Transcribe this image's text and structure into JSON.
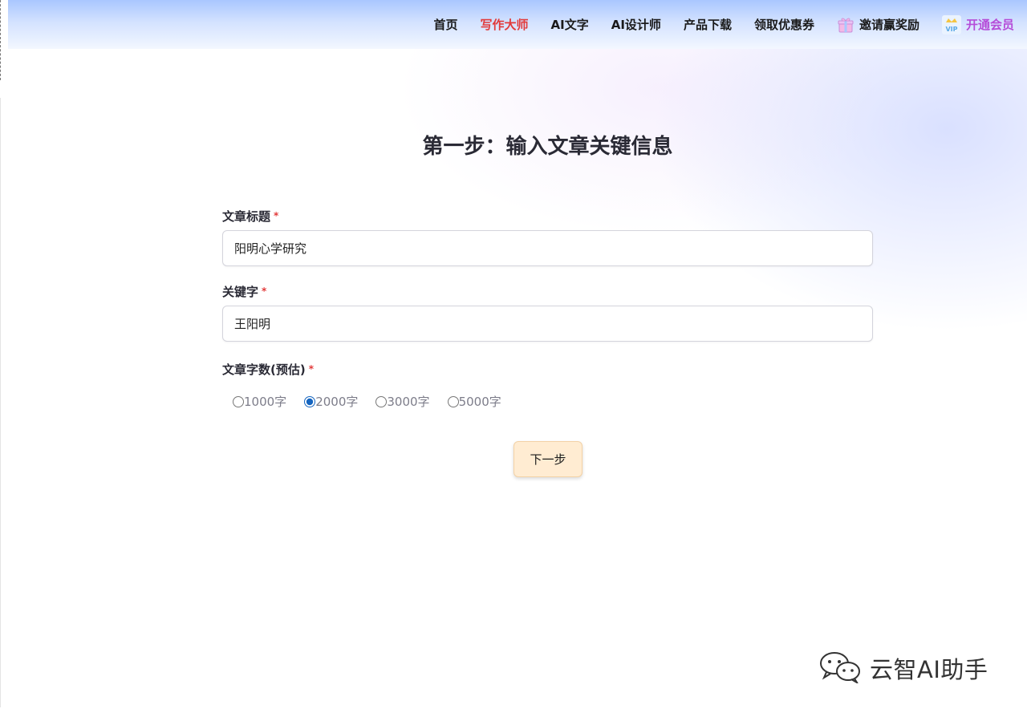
{
  "nav": {
    "items": [
      {
        "label": "首页"
      },
      {
        "label": "写作大师",
        "active": true
      },
      {
        "label": "AI文字"
      },
      {
        "label": "AI设计师"
      },
      {
        "label": "产品下载"
      },
      {
        "label": "领取优惠券"
      },
      {
        "label": "邀请赢奖励",
        "icon": "gift-icon"
      },
      {
        "label": "开通会员",
        "icon": "vip-icon"
      }
    ],
    "vip_badge_text": "VIP",
    "active_color": "#e23a3a",
    "vip_color": "#b54cd8"
  },
  "step_title": "第一步：输入文章关键信息",
  "form": {
    "required_mark": "*",
    "title_field": {
      "label": "文章标题",
      "value": "阳明心学研究"
    },
    "keyword_field": {
      "label": "关键字",
      "value": "王阳明"
    },
    "word_count": {
      "label": "文章字数(预估)",
      "options": [
        "1000字",
        "2000字",
        "3000字",
        "5000字"
      ],
      "selected": "2000字"
    },
    "next_button": "下一步"
  },
  "watermark": {
    "text": "云智AI助手",
    "icon": "wechat-icon"
  },
  "colors": {
    "button_bg": "#ffecd2",
    "header_top": "#a9c6ff"
  }
}
